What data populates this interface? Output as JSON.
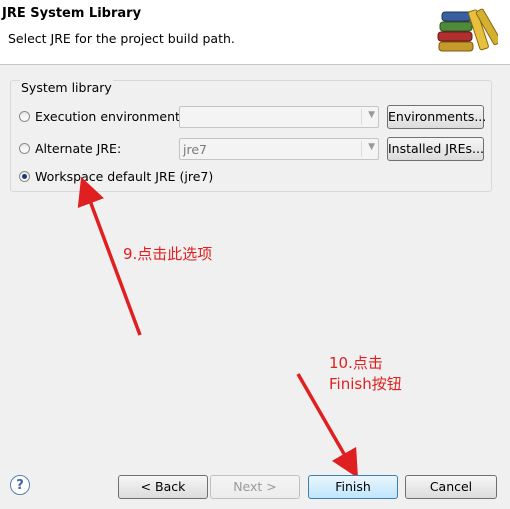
{
  "header": {
    "title": "JRE System Library",
    "description": "Select JRE for the project build path."
  },
  "group": {
    "label": "System library",
    "options": [
      {
        "label": "Execution environment:",
        "checked": false,
        "combo_value": "",
        "button": "Environments..."
      },
      {
        "label": "Alternate JRE:",
        "checked": false,
        "combo_value": "jre7",
        "button": "Installed JREs..."
      },
      {
        "label": "Workspace default JRE (jre7)",
        "checked": true
      }
    ]
  },
  "annotations": {
    "step9": "9.点击此选项",
    "step10_line1": "10.点击",
    "step10_line2": "Finish按钮",
    "color": "#e02020"
  },
  "footer": {
    "help_symbol": "?",
    "back": "< Back",
    "next": "Next >",
    "finish": "Finish",
    "cancel": "Cancel"
  }
}
